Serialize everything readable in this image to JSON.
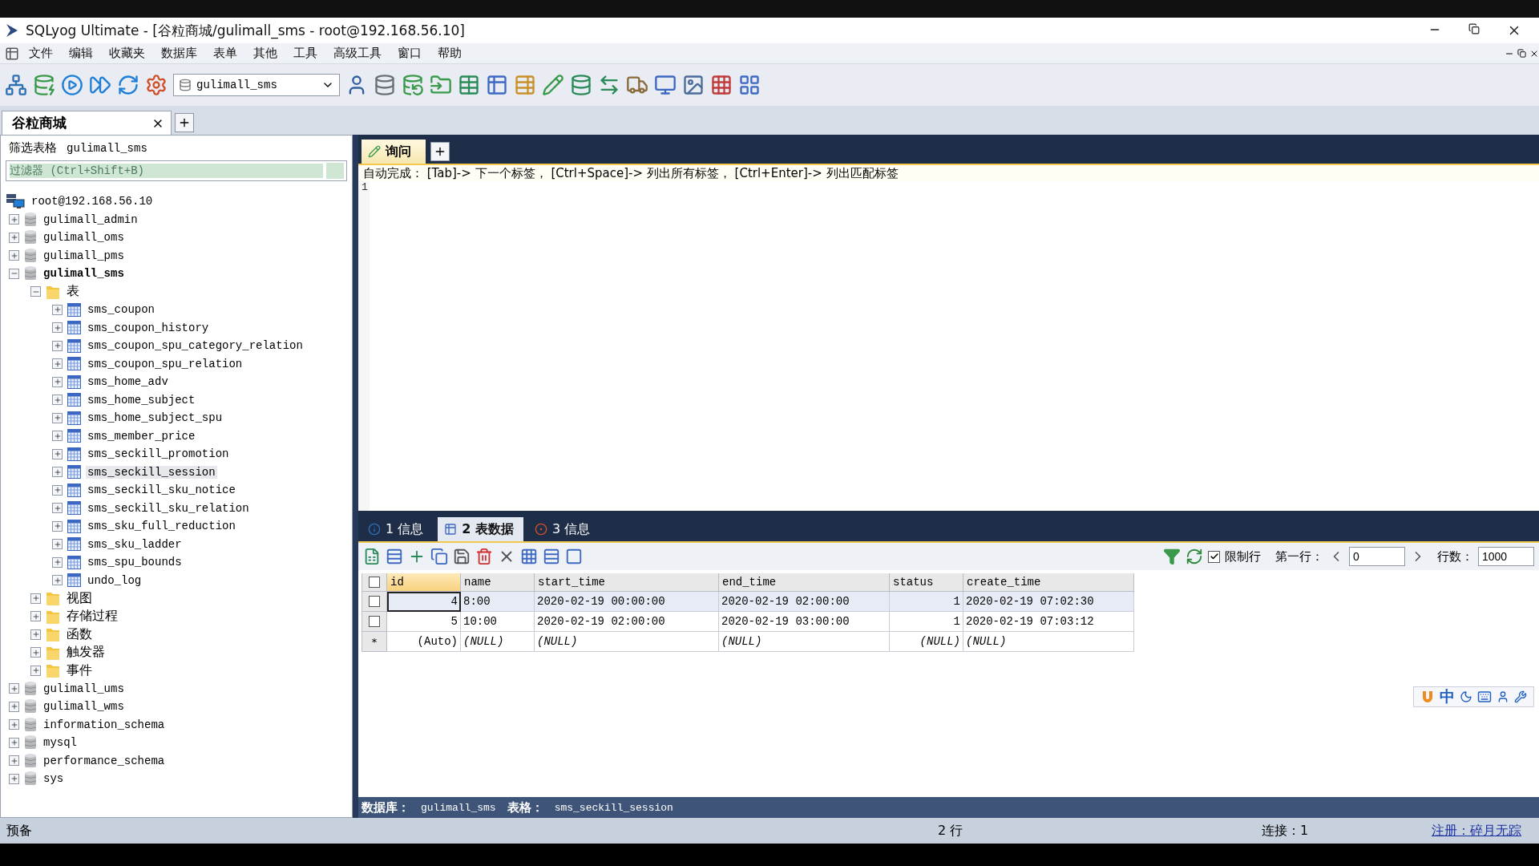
{
  "window": {
    "title": "SQLyog Ultimate - [谷粒商城/gulimall_sms - root@192.168.56.10]"
  },
  "menu": [
    "文件",
    "编辑",
    "收藏夹",
    "数据库",
    "表单",
    "其他",
    "工具",
    "高级工具",
    "窗口",
    "帮助"
  ],
  "toolbar": {
    "database_dropdown": "gulimall_sms"
  },
  "connection_tabs": [
    {
      "label": "谷粒商城",
      "selected": true
    }
  ],
  "object_browser": {
    "filter_label": "筛选表格",
    "filter_database": "gulimall_sms",
    "filter_placeholder": "过滤器 (Ctrl+Shift+B)",
    "tree": [
      {
        "label": "root@192.168.56.10",
        "kind": "server",
        "selected": false,
        "children": [
          {
            "label": "gulimall_admin",
            "kind": "database",
            "expanded": false,
            "selected": false
          },
          {
            "label": "gulimall_oms",
            "kind": "database",
            "expanded": false,
            "selected": false
          },
          {
            "label": "gulimall_pms",
            "kind": "database",
            "expanded": false,
            "selected": false
          },
          {
            "label": "gulimall_sms",
            "kind": "database",
            "expanded": true,
            "selected": false,
            "bold": true,
            "children": [
              {
                "label": "表",
                "kind": "folder",
                "expanded": true,
                "selected": false,
                "children": [
                  {
                    "label": "sms_coupon",
                    "kind": "table",
                    "expanded": false,
                    "selected": false
                  },
                  {
                    "label": "sms_coupon_history",
                    "kind": "table",
                    "expanded": false,
                    "selected": false
                  },
                  {
                    "label": "sms_coupon_spu_category_relation",
                    "kind": "table",
                    "expanded": false,
                    "selected": false
                  },
                  {
                    "label": "sms_coupon_spu_relation",
                    "kind": "table",
                    "expanded": false,
                    "selected": false
                  },
                  {
                    "label": "sms_home_adv",
                    "kind": "table",
                    "expanded": false,
                    "selected": false
                  },
                  {
                    "label": "sms_home_subject",
                    "kind": "table",
                    "expanded": false,
                    "selected": false
                  },
                  {
                    "label": "sms_home_subject_spu",
                    "kind": "table",
                    "expanded": false,
                    "selected": false
                  },
                  {
                    "label": "sms_member_price",
                    "kind": "table",
                    "expanded": false,
                    "selected": false
                  },
                  {
                    "label": "sms_seckill_promotion",
                    "kind": "table",
                    "expanded": false,
                    "selected": false
                  },
                  {
                    "label": "sms_seckill_session",
                    "kind": "table",
                    "expanded": false,
                    "selected": true
                  },
                  {
                    "label": "sms_seckill_sku_notice",
                    "kind": "table",
                    "expanded": false,
                    "selected": false
                  },
                  {
                    "label": "sms_seckill_sku_relation",
                    "kind": "table",
                    "expanded": false,
                    "selected": false
                  },
                  {
                    "label": "sms_sku_full_reduction",
                    "kind": "table",
                    "expanded": false,
                    "selected": false
                  },
                  {
                    "label": "sms_sku_ladder",
                    "kind": "table",
                    "expanded": false,
                    "selected": false
                  },
                  {
                    "label": "sms_spu_bounds",
                    "kind": "table",
                    "expanded": false,
                    "selected": false
                  },
                  {
                    "label": "undo_log",
                    "kind": "table",
                    "expanded": false,
                    "selected": false
                  }
                ]
              },
              {
                "label": "视图",
                "kind": "folder",
                "expanded": false,
                "selected": false
              },
              {
                "label": "存储过程",
                "kind": "folder",
                "expanded": false,
                "selected": false
              },
              {
                "label": "函数",
                "kind": "folder",
                "expanded": false,
                "selected": false
              },
              {
                "label": "触发器",
                "kind": "folder",
                "expanded": false,
                "selected": false
              },
              {
                "label": "事件",
                "kind": "folder",
                "expanded": false,
                "selected": false
              }
            ]
          },
          {
            "label": "gulimall_ums",
            "kind": "database",
            "expanded": false,
            "selected": false
          },
          {
            "label": "gulimall_wms",
            "kind": "database",
            "expanded": false,
            "selected": false
          },
          {
            "label": "information_schema",
            "kind": "database",
            "expanded": false,
            "selected": false
          },
          {
            "label": "mysql",
            "kind": "database",
            "expanded": false,
            "selected": false
          },
          {
            "label": "performance_schema",
            "kind": "database",
            "expanded": false,
            "selected": false
          },
          {
            "label": "sys",
            "kind": "database",
            "expanded": false,
            "selected": false
          }
        ]
      }
    ]
  },
  "query_tabs": [
    {
      "label": "询问",
      "selected": true
    }
  ],
  "editor": {
    "hint": "自动完成： [Tab]-> 下一个标签， [Ctrl+Space]-> 列出所有标签， [Ctrl+Enter]-> 列出匹配标签",
    "line_numbers": [
      "1"
    ]
  },
  "result_tabs": [
    {
      "label": "1 信息",
      "kind": "info",
      "selected": false
    },
    {
      "label": "2 表数据",
      "kind": "table",
      "selected": true
    },
    {
      "label": "3 信息",
      "kind": "messages",
      "selected": false
    }
  ],
  "result_toolbar": {
    "limit_label": "限制行",
    "limit_checked": true,
    "first_row_label": "第一行：",
    "first_row": "0",
    "row_count_label": "行数：",
    "row_count": "1000"
  },
  "table": {
    "select_all_checked": false,
    "columns": [
      {
        "label": "id",
        "numeric": true
      },
      {
        "label": "name",
        "numeric": false
      },
      {
        "label": "start_time",
        "numeric": false
      },
      {
        "label": "end_time",
        "numeric": false
      },
      {
        "label": "status",
        "numeric": true
      },
      {
        "label": "create_time",
        "numeric": false
      }
    ],
    "rows": [
      {
        "kind": "data",
        "selected": true,
        "checked": false,
        "cells": [
          "4",
          "8:00",
          "2020-02-19 00:00:00",
          "2020-02-19 02:00:00",
          "1",
          "2020-02-19 07:02:30"
        ]
      },
      {
        "kind": "data",
        "selected": false,
        "checked": false,
        "cells": [
          "5",
          "10:00",
          "2020-02-19 02:00:00",
          "2020-02-19 03:00:00",
          "1",
          "2020-02-19 07:03:12"
        ]
      },
      {
        "kind": "new",
        "selected": false,
        "marker": "*",
        "cells": [
          "(Auto)",
          "(NULL)",
          "(NULL)",
          "(NULL)",
          "(NULL)",
          "(NULL)"
        ]
      }
    ]
  },
  "info_bar": {
    "database_label": "数据库：",
    "database": "gulimall_sms",
    "table_label": "表格：",
    "table": "sms_seckill_session"
  },
  "ime_bar": {
    "mode": "中"
  },
  "status_bar": {
    "state": "预备",
    "rows": "2 行",
    "connections": "连接：1",
    "registration": "注册：碎月无踪"
  }
}
